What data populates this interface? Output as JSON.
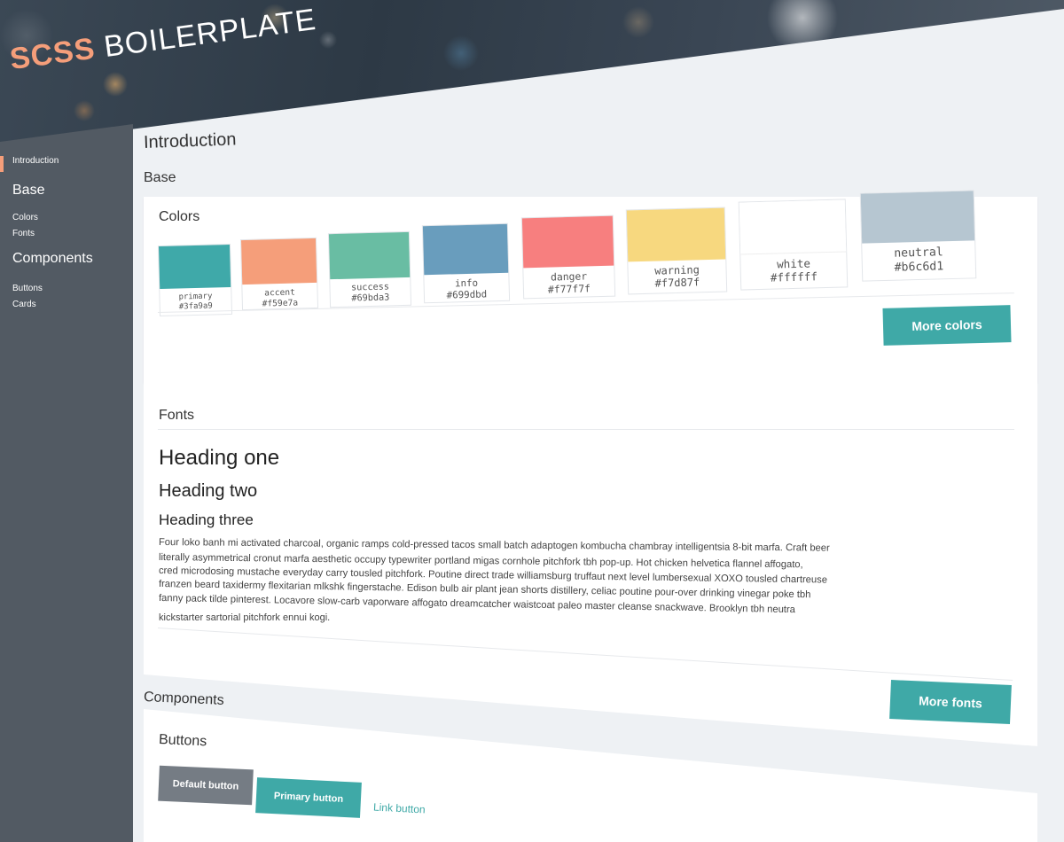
{
  "brand": {
    "first": "SCSS",
    "second": "BOILERPLATE"
  },
  "sidebar": {
    "active_item": "Introduction",
    "base_heading": "Base",
    "base_items": [
      "Colors",
      "Fonts"
    ],
    "components_heading": "Components",
    "components_items": [
      "Buttons",
      "Cards"
    ]
  },
  "main": {
    "title": "Introduction",
    "base_title": "Base",
    "components_title": "Components"
  },
  "colors_card": {
    "title": "Colors",
    "swatches": [
      {
        "name": "primary",
        "hex": "#3fa9a9"
      },
      {
        "name": "accent",
        "hex": "#f59e7a"
      },
      {
        "name": "success",
        "hex": "#69bda3"
      },
      {
        "name": "info",
        "hex": "#699dbd"
      },
      {
        "name": "danger",
        "hex": "#f77f7f"
      },
      {
        "name": "warning",
        "hex": "#f7d87f"
      },
      {
        "name": "white",
        "hex": "#ffffff"
      },
      {
        "name": "neutral",
        "hex": "#b6c6d1"
      }
    ],
    "more_button": "More colors"
  },
  "fonts_card": {
    "title": "Fonts",
    "heading_one": "Heading one",
    "heading_two": "Heading two",
    "heading_three": "Heading three",
    "paragraph_lines": [
      "Four loko banh mi activated charcoal, organic ramps cold-pressed tacos small batch adaptogen kombucha chambray intelligentsia 8-bit marfa. Craft beer",
      "literally asymmetrical cronut marfa aesthetic occupy typewriter portland migas cornhole pitchfork tbh pop-up. Hot chicken helvetica flannel affogato,",
      "cred microdosing mustache everyday carry tousled pitchfork. Poutine direct trade williamsburg truffaut next level lumbersexual XOXO tousled chartreuse",
      "franzen beard taxidermy flexitarian mlkshk fingerstache. Edison bulb air plant jean shorts distillery, celiac poutine pour-over drinking vinegar poke tbh",
      "fanny pack tilde pinterest. Locavore slow-carb vaporware affogato dreamcatcher waistcoat paleo master cleanse snackwave. Brooklyn tbh neutra",
      "kickstarter sartorial pitchfork ennui kogi."
    ],
    "more_button": "More fonts"
  },
  "buttons_card": {
    "title": "Buttons",
    "default_label": "Default button",
    "primary_label": "Primary button",
    "link_label": "Link button"
  }
}
